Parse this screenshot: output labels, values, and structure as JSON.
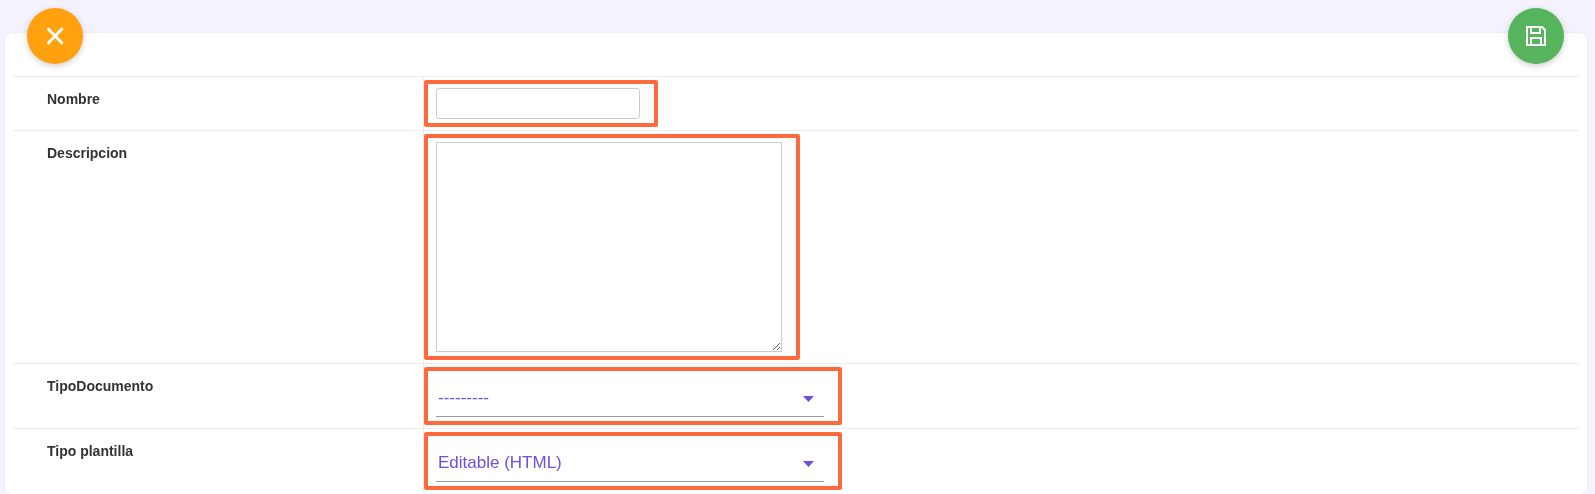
{
  "toolbar": {
    "close_button": {
      "label": "×"
    }
  },
  "fields": [
    {
      "label": "Nombre",
      "kind": "input",
      "highlighted": true
    },
    {
      "label": "Descripcion",
      "kind": "textarea",
      "highlighted": true
    },
    {
      "label": "TipoDocumento",
      "kind": "select",
      "value": "---------",
      "highlighted": true
    },
    {
      "label": "Tipo plantilla",
      "kind": "select",
      "value": "Editable (HTML)",
      "highlighted": true
    }
  ]
}
